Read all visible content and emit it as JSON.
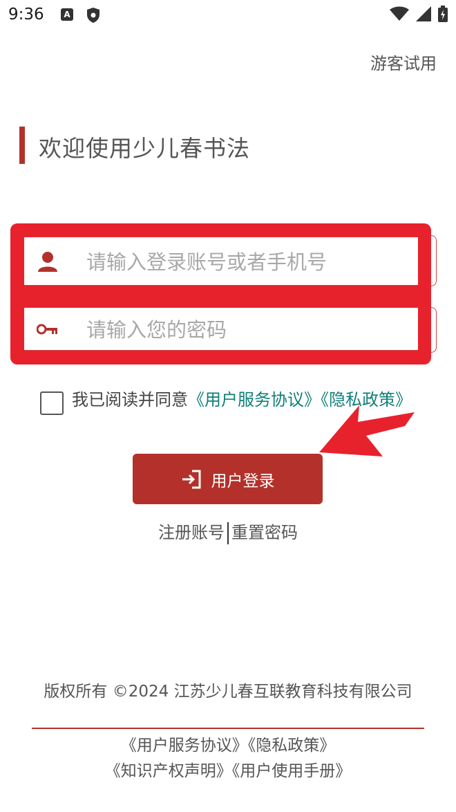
{
  "status_bar": {
    "time": "9:36",
    "a_badge": "A",
    "icons": [
      "a-badge-icon",
      "shield-icon",
      "wifi-icon",
      "signal-icon",
      "battery-icon"
    ]
  },
  "guest_label": "游客试用",
  "welcome_title": "欢迎使用少儿春书法",
  "login_form": {
    "account_placeholder": "请输入登录账号或者手机号",
    "password_placeholder": "请输入您的密码",
    "account_value": "",
    "password_value": ""
  },
  "agreement": {
    "checked": false,
    "prefix": "我已阅读并同意",
    "service_link": "《用户服务协议》",
    "privacy_link": "《隐私政策》"
  },
  "login_button_label": "用户登录",
  "register_label": "注册账号",
  "reset_label": "重置密码",
  "footer": {
    "copyright": "版权所有 ©2024 江苏少儿春互联教育科技有限公司",
    "service_link": "《用户服务协议》",
    "privacy_link": "《隐私政策》",
    "ip_link": "《知识产权声明》",
    "manual_link": "《用户使用手册》"
  },
  "colors": {
    "brand_red": "#b3312a",
    "highlight_red": "#e8222d",
    "link_teal": "#0e7f79"
  }
}
